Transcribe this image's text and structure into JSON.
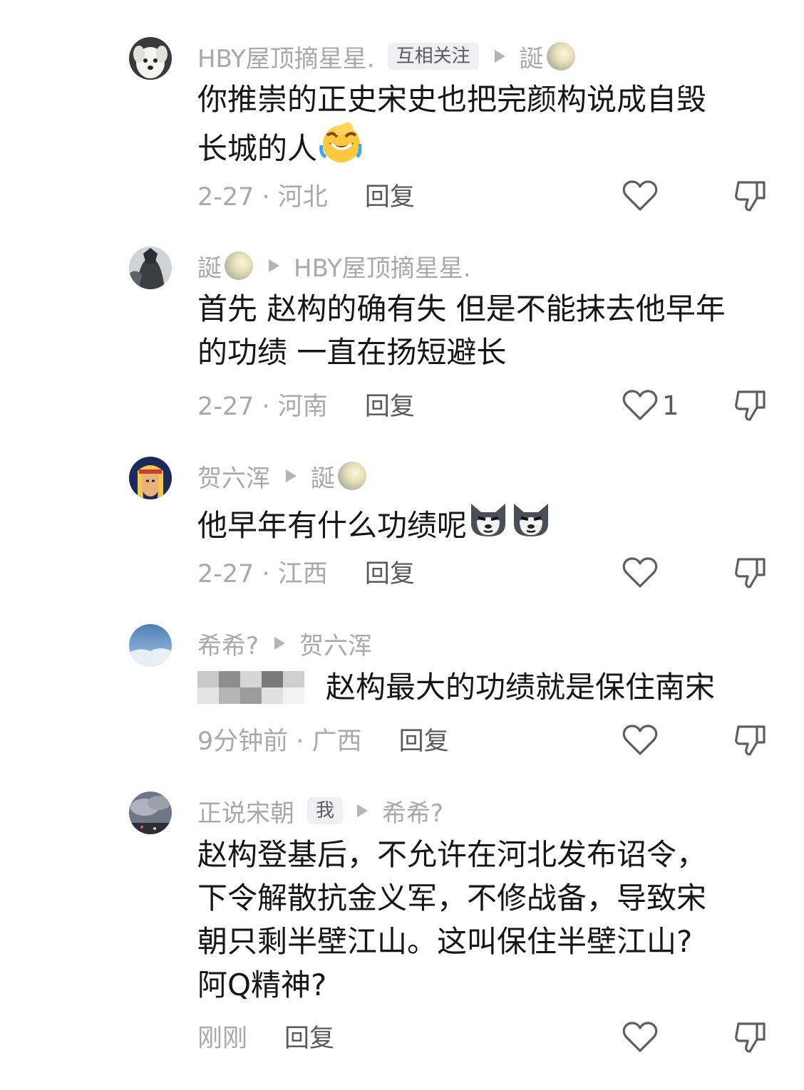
{
  "comments": [
    {
      "id": "c1",
      "user": "HBY屋顶摘星星.",
      "tag": "互相关注",
      "reply_to": "誕",
      "text_lines": [
        "你推崇的正史宋史也把完颜构说成自毁",
        "长城的人"
      ],
      "date_location": "2-27 · 河北",
      "reply_label": "回复",
      "likes": "",
      "emoji": "laugh-cry-emoji"
    },
    {
      "id": "c2",
      "user": "誕",
      "reply_to": "HBY屋顶摘星星.",
      "text_lines": [
        "首先 赵构的确有失 但是不能抹去他早年",
        "的功绩 一直在扬短避长"
      ],
      "date_location": "2-27 · 河南",
      "reply_label": "回复",
      "likes": "1"
    },
    {
      "id": "c3",
      "user": "贺六浑",
      "reply_to": "誕",
      "text_lines": [
        "他早年有什么功绩呢"
      ],
      "date_location": "2-27 · 江西",
      "reply_label": "回复",
      "likes": "",
      "emoji": "smirking-dog-emoji"
    },
    {
      "id": "c4",
      "user": "希希?",
      "reply_to": "贺六浑",
      "text_lines": [
        "赵构最大的功绩就是保住南宋"
      ],
      "date_location": "9分钟前 · 广西",
      "reply_label": "回复",
      "likes": ""
    },
    {
      "id": "c5",
      "user": "正说宋朝",
      "tag": "我",
      "reply_to": "希希?",
      "text_lines": [
        "赵构登基后，不允许在河北发布诏令，",
        "下令解散抗金义军，不修战备，导致宋",
        "朝只剩半壁江山。这叫保住半壁江山?",
        "阿Q精神?"
      ],
      "date_location": "刚刚",
      "reply_label": "回复",
      "likes": ""
    }
  ],
  "colors": {
    "meta": "#a9a9ad",
    "text": "#161616",
    "reply": "#5a5a5e",
    "tag_bg": "#f0f0f2"
  }
}
